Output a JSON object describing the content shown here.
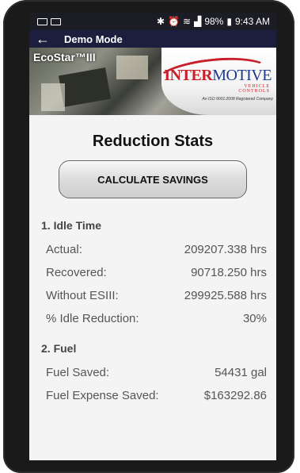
{
  "status_bar": {
    "battery": "98%",
    "time": "9:43 AM"
  },
  "app_bar": {
    "back_icon": "arrow-left-icon",
    "title": "Demo Mode"
  },
  "banner": {
    "product": "EcoStar™III",
    "logo_inter": "INTER",
    "logo_motive": "MOTIVE",
    "logo_sub_1": "VEHICLE",
    "logo_sub_2": "CONTROLS",
    "logo_iso": "An ISO 9001:2008 Registered Company"
  },
  "main": {
    "title": "Reduction Stats",
    "calculate_label": "CALCULATE SAVINGS",
    "idle": {
      "title": "1. Idle Time",
      "rows": [
        {
          "label": "Actual:",
          "value": "209207.338 hrs"
        },
        {
          "label": "Recovered:",
          "value": "90718.250 hrs"
        },
        {
          "label": "Without ESIII:",
          "value": "299925.588 hrs"
        },
        {
          "label": "% Idle Reduction:",
          "value": "30%"
        }
      ]
    },
    "fuel": {
      "title": "2. Fuel",
      "rows": [
        {
          "label": "Fuel Saved:",
          "value": "54431 gal"
        },
        {
          "label": "Fuel Expense Saved:",
          "value": "$163292.86"
        }
      ]
    }
  },
  "colors": {
    "app_bar": "#1b1f3d",
    "logo_red": "#c8202a",
    "logo_blue": "#1c3a8a"
  }
}
